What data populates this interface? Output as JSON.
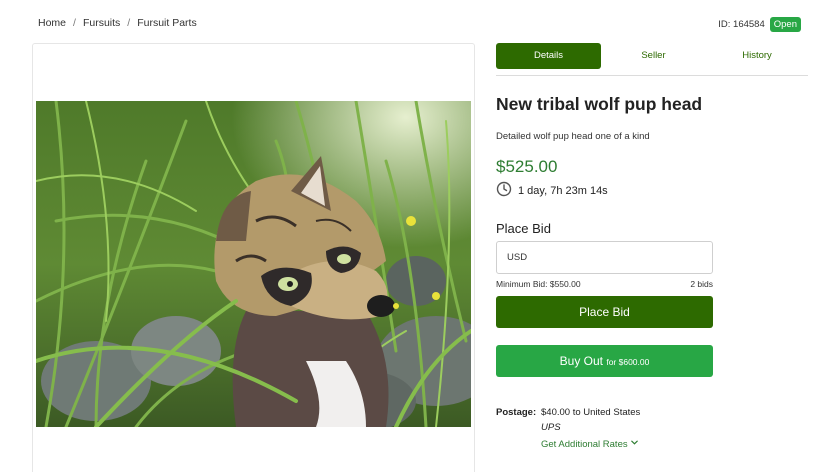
{
  "breadcrumb": {
    "items": [
      "Home",
      "Fursuits",
      "Fursuit Parts"
    ]
  },
  "listing": {
    "id_label": "ID: 164584",
    "status": "Open",
    "title": "New tribal wolf pup head",
    "description": "Detailed wolf pup head one of a kind",
    "current_price": "$525.00",
    "time_left": "1 day, 7h 23m 14s"
  },
  "tabs": [
    {
      "label": "Details",
      "active": true
    },
    {
      "label": "Seller",
      "active": false
    },
    {
      "label": "History",
      "active": false
    }
  ],
  "bid": {
    "label": "Place Bid",
    "currency_placeholder": "USD",
    "minimum_bid": "Minimum Bid: $550.00",
    "bid_count": "2 bids",
    "button_label": "Place Bid"
  },
  "buyout": {
    "label": "Buy Out",
    "price_text": "for $600.00"
  },
  "postage": {
    "label": "Postage:",
    "value": "$40.00 to United States",
    "carrier": "UPS",
    "rates_link": "Get Additional Rates"
  },
  "colors": {
    "primary_dark_green": "#2d6a00",
    "accent_green": "#28a745",
    "price_green": "#2e7d32"
  },
  "icons": {
    "timer": "clock-icon",
    "rates": "chevron-down-icon"
  }
}
